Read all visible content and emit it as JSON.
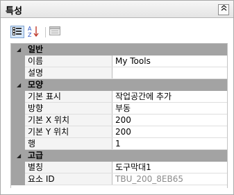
{
  "panel": {
    "title": "특성",
    "collapse_glyph": "⌃"
  },
  "toolbar": {
    "buttons": [
      {
        "name": "categorized-icon",
        "active": true
      },
      {
        "name": "alphabetical-sort-icon",
        "active": false
      },
      {
        "name": "property-pages-icon",
        "active": false
      }
    ]
  },
  "categories": [
    {
      "name": "일반",
      "rows": [
        {
          "label": "이름",
          "value": "My Tools",
          "readonly": false
        },
        {
          "label": "설명",
          "value": "",
          "readonly": false
        }
      ]
    },
    {
      "name": "모양",
      "rows": [
        {
          "label": "기본 표시",
          "value": "작업공간에 추가",
          "readonly": false
        },
        {
          "label": "방향",
          "value": "부동",
          "readonly": false
        },
        {
          "label": "기본 X 위치",
          "value": "200",
          "readonly": false
        },
        {
          "label": "기본 Y 위치",
          "value": "200",
          "readonly": false
        },
        {
          "label": "행",
          "value": "1",
          "readonly": false
        }
      ]
    },
    {
      "name": "고급",
      "rows": [
        {
          "label": "별칭",
          "value": "도구막대1",
          "readonly": false
        },
        {
          "label": "요소 ID",
          "value": "TBU_200_8EB65",
          "readonly": true
        }
      ]
    }
  ],
  "colors": {
    "category_band": "#a3a3a3",
    "readonly_text": "#8a8a8a",
    "active_button": "#d5e6fa"
  }
}
